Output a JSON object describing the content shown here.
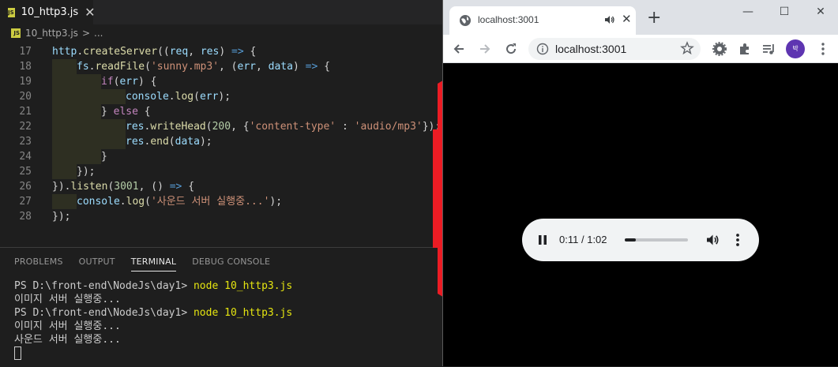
{
  "editor": {
    "tab_label": "10_http3.js",
    "tab_close": "✕",
    "breadcrumb_file": "10_http3.js",
    "breadcrumb_sep": ">",
    "breadcrumb_more": "...",
    "file_icon_label": "JS",
    "code_lines": [
      {
        "num": "17",
        "indent": 0,
        "tokens": [
          [
            "v",
            "http"
          ],
          [
            "p",
            "."
          ],
          [
            "f",
            "createServer"
          ],
          [
            "p",
            "(("
          ],
          [
            "v",
            "req"
          ],
          [
            "p",
            ", "
          ],
          [
            "v",
            "res"
          ],
          [
            "p",
            ") "
          ],
          [
            "o",
            "=>"
          ],
          [
            "p",
            " {"
          ]
        ]
      },
      {
        "num": "18",
        "indent": 1,
        "tokens": [
          [
            "v",
            "fs"
          ],
          [
            "p",
            "."
          ],
          [
            "f",
            "readFile"
          ],
          [
            "p",
            "("
          ],
          [
            "s",
            "'sunny.mp3'"
          ],
          [
            "p",
            ", ("
          ],
          [
            "v",
            "err"
          ],
          [
            "p",
            ", "
          ],
          [
            "v",
            "data"
          ],
          [
            "p",
            ") "
          ],
          [
            "o",
            "=>"
          ],
          [
            "p",
            " {"
          ]
        ]
      },
      {
        "num": "19",
        "indent": 2,
        "tokens": [
          [
            "k",
            "if"
          ],
          [
            "p",
            "("
          ],
          [
            "v",
            "err"
          ],
          [
            "p",
            ") {"
          ]
        ]
      },
      {
        "num": "20",
        "indent": 3,
        "tokens": [
          [
            "v",
            "console"
          ],
          [
            "p",
            "."
          ],
          [
            "f",
            "log"
          ],
          [
            "p",
            "("
          ],
          [
            "v",
            "err"
          ],
          [
            "p",
            ");"
          ]
        ]
      },
      {
        "num": "21",
        "indent": 2,
        "tokens": [
          [
            "p",
            "} "
          ],
          [
            "k",
            "else"
          ],
          [
            "p",
            " {"
          ]
        ]
      },
      {
        "num": "22",
        "indent": 3,
        "tokens": [
          [
            "v",
            "res"
          ],
          [
            "p",
            "."
          ],
          [
            "f",
            "writeHead"
          ],
          [
            "p",
            "("
          ],
          [
            "n",
            "200"
          ],
          [
            "p",
            ", {"
          ],
          [
            "s",
            "'content-type'"
          ],
          [
            "p",
            " : "
          ],
          [
            "s",
            "'audio/mp3'"
          ],
          [
            "p",
            "});"
          ]
        ]
      },
      {
        "num": "23",
        "indent": 3,
        "tokens": [
          [
            "v",
            "res"
          ],
          [
            "p",
            "."
          ],
          [
            "f",
            "end"
          ],
          [
            "p",
            "("
          ],
          [
            "v",
            "data"
          ],
          [
            "p",
            ");"
          ]
        ]
      },
      {
        "num": "24",
        "indent": 2,
        "tokens": [
          [
            "p",
            "}"
          ]
        ]
      },
      {
        "num": "25",
        "indent": 1,
        "tokens": [
          [
            "p",
            "});"
          ]
        ]
      },
      {
        "num": "26",
        "indent": 0,
        "tokens": [
          [
            "p",
            "})."
          ],
          [
            "f",
            "listen"
          ],
          [
            "p",
            "("
          ],
          [
            "n",
            "3001"
          ],
          [
            "p",
            ", () "
          ],
          [
            "o",
            "=>"
          ],
          [
            "p",
            " {"
          ]
        ]
      },
      {
        "num": "27",
        "indent": 1,
        "tokens": [
          [
            "v",
            "console"
          ],
          [
            "p",
            "."
          ],
          [
            "f",
            "log"
          ],
          [
            "p",
            "("
          ],
          [
            "s",
            "'사운드 서버 실행중...'"
          ],
          [
            "p",
            ");"
          ]
        ]
      },
      {
        "num": "28",
        "indent": 0,
        "tokens": [
          [
            "p",
            "});"
          ]
        ]
      }
    ]
  },
  "panel": {
    "tabs": [
      {
        "label": "PROBLEMS",
        "active": false
      },
      {
        "label": "OUTPUT",
        "active": false
      },
      {
        "label": "TERMINAL",
        "active": true
      },
      {
        "label": "DEBUG CONSOLE",
        "active": false
      }
    ],
    "terminal_lines": [
      {
        "prompt": "PS D:\\front-end\\NodeJs\\day1> ",
        "cmd": "node 10_http3.js"
      },
      {
        "text": "이미지 서버 실행중..."
      },
      {
        "prompt": "PS D:\\front-end\\NodeJs\\day1> ",
        "cmd": "node 10_http3.js"
      },
      {
        "text": "이미지 서버 실행중..."
      },
      {
        "text": "사운드 서버 실행중..."
      }
    ]
  },
  "browser": {
    "tab_title": "localhost:3001",
    "tab_close": "✕",
    "new_tab": "+",
    "url": "localhost:3001",
    "avatar_text": "박",
    "window_controls": [
      "—",
      "☐",
      "✕"
    ],
    "player": {
      "current_time": "0:11",
      "separator": "/",
      "duration": "1:02",
      "progress_fraction": 0.18
    }
  },
  "colors": {
    "arrow": "#ec1c24",
    "avatar": "#5e35b1"
  }
}
